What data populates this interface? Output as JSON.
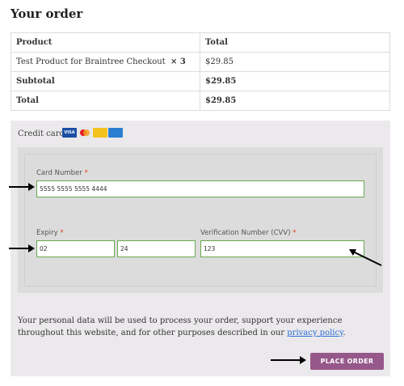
{
  "page": {
    "title": "Your order"
  },
  "order_table": {
    "headers": [
      "Product",
      "Total"
    ],
    "rows": [
      {
        "product": "Test Product for Braintree Checkout",
        "qty": "× 3",
        "total": "$29.85"
      },
      {
        "label": "Subtotal",
        "total": "$29.85"
      },
      {
        "label": "Total",
        "total": "$29.85"
      }
    ]
  },
  "payment": {
    "method_label": "Credit card",
    "card_icons": [
      {
        "name": "visa-icon",
        "text": "VISA",
        "color": "#1a4fa3"
      },
      {
        "name": "mastercard-icon",
        "text": "",
        "color": "#e21b23"
      },
      {
        "name": "maestro-icon",
        "text": "",
        "color": "#f4c21d"
      },
      {
        "name": "amex-icon",
        "text": "",
        "color": "#2a7fd0"
      }
    ],
    "card_number": {
      "label": "Card Number",
      "required": "*",
      "value": "5555 5555 5555 4444"
    },
    "expiry": {
      "label": "Expiry",
      "required": "*",
      "month": "02",
      "year": "24"
    },
    "cvv": {
      "label": "Verification Number (CVV)",
      "required": "*",
      "value": "123"
    }
  },
  "privacy": {
    "text": "Your personal data will be used to process your order, support your experience throughout this website, and for other purposes described in our ",
    "link": "privacy policy",
    "end": "."
  },
  "button": {
    "place_order": "PLACE ORDER",
    "color": "#96588a"
  },
  "colors": {
    "field_border": "#6aa84f",
    "required": "#e2401c",
    "link": "#2a6fd6"
  }
}
